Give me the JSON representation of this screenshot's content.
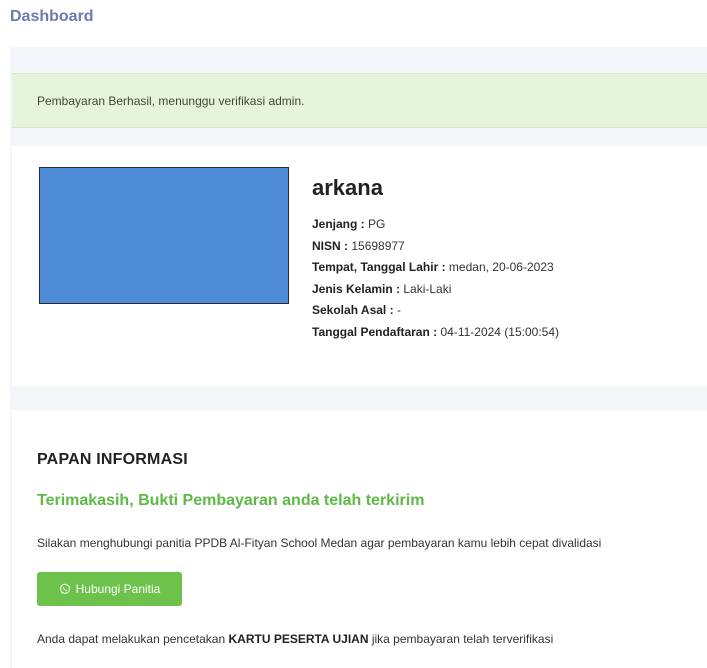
{
  "header": {
    "title": "Dashboard"
  },
  "alert": {
    "message": "Pembayaran Berhasil, menunggu verifikasi admin."
  },
  "profile": {
    "name": "arkana",
    "fields": [
      {
        "label": "Jenjang :",
        "value": "PG"
      },
      {
        "label": "NISN :",
        "value": "15698977"
      },
      {
        "label": "Tempat, Tanggal Lahir :",
        "value": "medan, 20-06-2023"
      },
      {
        "label": "Jenis Kelamin :",
        "value": "Laki-Laki"
      },
      {
        "label": "Sekolah Asal :",
        "value": "-"
      },
      {
        "label": "Tanggal Pendaftaran :",
        "value": "04-11-2024 (15:00:54)"
      }
    ]
  },
  "info": {
    "title": "PAPAN INFORMASI",
    "subtitle": "Terimakasih, Bukti Pembayaran anda telah terkirim",
    "description": "Silakan menghubungi panitia PPDB Al-Fityan School Medan agar pembayaran kamu lebih cepat divalidasi",
    "button_label": "Hubungi Panitia",
    "button_icon": "whatsapp-icon",
    "note_prefix": "Anda dapat melakukan pencetakan ",
    "note_bold": "KARTU PESERTA UJIAN",
    "note_suffix": " jika pembayaran telah terverifikasi"
  },
  "colors": {
    "title": "#6c7bb0",
    "alert_bg": "#e6f4dc",
    "photo_fill": "#4e8bd6",
    "accent_green": "#5fb946",
    "button_bg": "#6cc24a"
  }
}
